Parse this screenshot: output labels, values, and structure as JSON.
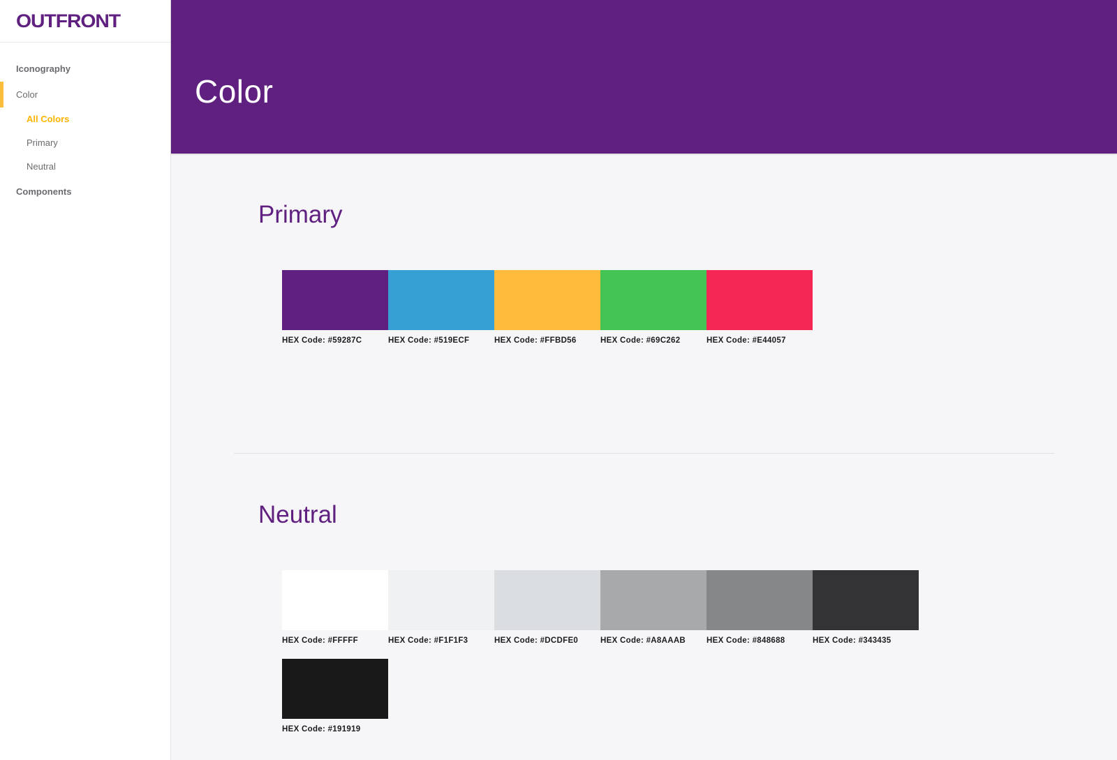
{
  "brand": {
    "logo_text": "OUTFRONT",
    "accent": "#5f2080",
    "highlight": "#ffbd3c"
  },
  "sidebar": {
    "items": [
      {
        "label": "Iconography"
      },
      {
        "label": "Color"
      },
      {
        "label": "Components"
      }
    ],
    "color_subitems": [
      {
        "label": "All Colors"
      },
      {
        "label": "Primary"
      },
      {
        "label": "Neutral"
      }
    ],
    "active_item": "Color",
    "active_subitem": "All Colors"
  },
  "header": {
    "title": "Color"
  },
  "sections": {
    "primary": {
      "title": "Primary",
      "swatches": [
        {
          "label": "HEX Code: #59287C",
          "color": "#5f2080"
        },
        {
          "label": "HEX Code: #519ECF",
          "color": "#36a0d4"
        },
        {
          "label": "HEX Code: #FFBD56",
          "color": "#ffbc3c"
        },
        {
          "label": "HEX Code: #69C262",
          "color": "#45c456"
        },
        {
          "label": "HEX Code: #E44057",
          "color": "#f42654"
        }
      ]
    },
    "neutral": {
      "title": "Neutral",
      "swatches": [
        {
          "label": "HEX Code: #FFFFF",
          "color": "#ffffff"
        },
        {
          "label": "HEX Code: #F1F1F3",
          "color": "#f0f1f3"
        },
        {
          "label": "HEX Code: #DCDFE0",
          "color": "#dadee0"
        },
        {
          "label": "HEX Code: #A8AAAB",
          "color": "#a7a9aa"
        },
        {
          "label": "HEX Code: #848688",
          "color": "#868789"
        },
        {
          "label": "HEX Code: #343435",
          "color": "#333335"
        },
        {
          "label": "HEX Code: #191919",
          "color": "#191919"
        }
      ]
    }
  }
}
